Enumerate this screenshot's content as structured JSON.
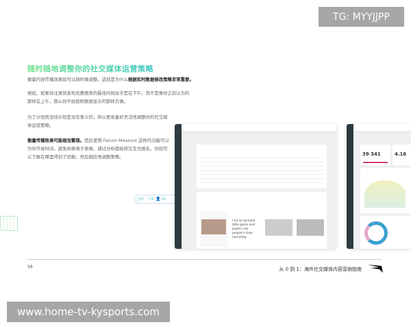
{
  "title": "随时随地调整你的社交媒体运营策略",
  "paragraphs": {
    "p1_text": "衡量内容传播效果就可以随时做调整。这就是为什么",
    "p1_bold": "根据实时数据修改策略非常重要。",
    "p2": "例如，如果你注意到发布优惠图表的最佳时间似乎是在下午，而不是像你之前认为的那样在上午，那么你不妨按照数据显示的那样去做。",
    "p3": "为了计划而坚持计划是没有意义的，所以要准备好灵活地调整你的社交媒体运营策略。",
    "p4_bold": "衡量传播效果可能相当繁琐。",
    "p4_text": "因此使用 Falcon Measure 这样的功能可以为你节省时间，避免依赖电子表格。通过分析面板和交互式报告，你就可以了解在哪里得到了回报，然后相应地调整策略。"
  },
  "social_stats": {
    "comments": "95",
    "likes": "5K",
    "followers": "1K"
  },
  "dashboard1": {
    "quote": "I try to sprinkle little gems and jewels into people's lives everyday."
  },
  "dashboard2": {
    "metric1": "39 341",
    "metric2": "4.16"
  },
  "footer": {
    "page_number": "16",
    "book_title": "从 0 到 1：海外社交媒体内容营销指南"
  },
  "watermarks": {
    "tg": "TG: MYYJJPP",
    "url": "www.home-tv-kysports.com"
  },
  "colors": {
    "title_gradient_start": "#6fe08a",
    "title_gradient_end": "#38c7c0",
    "sidebar": "#2d3a40"
  }
}
